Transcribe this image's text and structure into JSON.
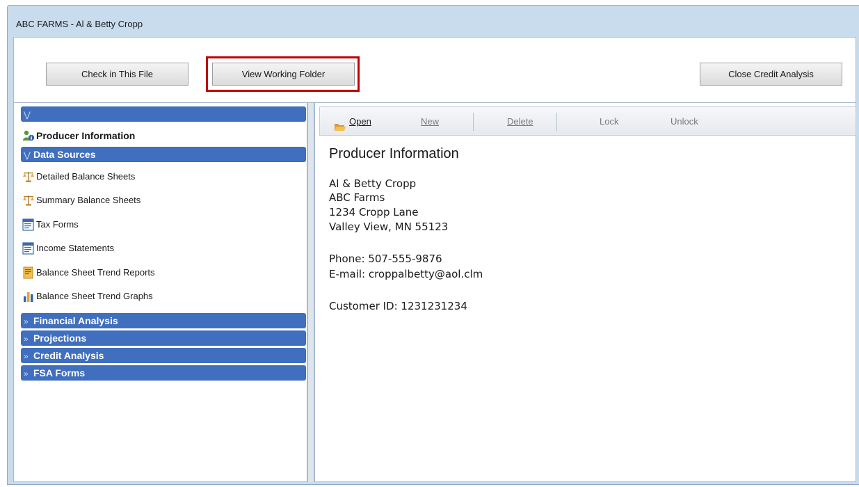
{
  "window": {
    "title": "ABC FARMS - Al & Betty Cropp"
  },
  "top_buttons": {
    "check_in": "Check in This File",
    "view_working_folder": "View Working Folder",
    "close_credit_analysis": "Close Credit Analysis"
  },
  "nav": {
    "collapse_glyph": "»",
    "expand_glyph": "«",
    "producer_information": "Producer Information",
    "data_sources": {
      "label": "Data Sources",
      "items": [
        {
          "label": "Detailed Balance Sheets",
          "icon": "scale-icon"
        },
        {
          "label": "Summary Balance Sheets",
          "icon": "scale-icon"
        },
        {
          "label": "Tax Forms",
          "icon": "form-icon"
        },
        {
          "label": "Income Statements",
          "icon": "form-icon"
        },
        {
          "label": "Balance Sheet Trend Reports",
          "icon": "report-icon"
        },
        {
          "label": "Balance Sheet Trend Graphs",
          "icon": "bar-chart-icon"
        }
      ]
    },
    "groups": [
      {
        "label": "Financial Analysis"
      },
      {
        "label": "Projections"
      },
      {
        "label": "Credit Analysis"
      },
      {
        "label": "FSA Forms"
      }
    ]
  },
  "toolbar": {
    "open": "Open",
    "new": "New",
    "delete": "Delete",
    "lock": "Lock",
    "unlock": "Unlock"
  },
  "content": {
    "title": "Producer Information",
    "name": "Al & Betty Cropp",
    "company": "ABC Farms",
    "street": "1234 Cropp Lane",
    "city": "Valley View, MN  55123",
    "phone": "Phone: 507-555-9876",
    "email": "E-mail: croppalbetty@aol.clm",
    "customer_id": "Customer ID: 1231231234"
  },
  "colors": {
    "group_header": "#3f6fbe",
    "window_frame": "#c9dcee",
    "highlight": "#c00000"
  }
}
